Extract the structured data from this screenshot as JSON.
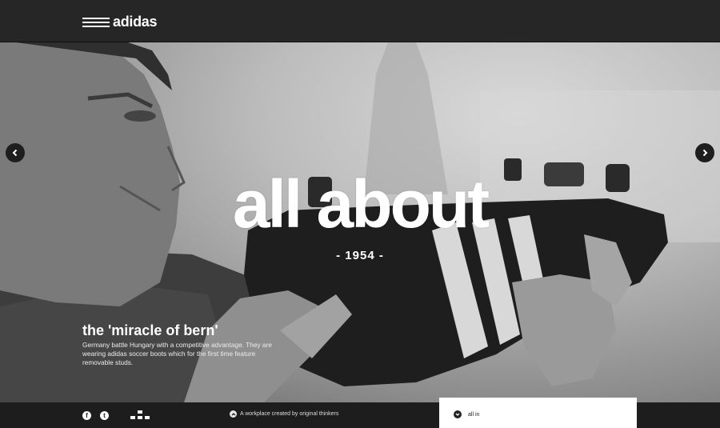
{
  "header": {
    "brand": "adidas"
  },
  "hero": {
    "headline": "all about",
    "year": "- 1954 -",
    "story_title": "the 'miracle of bern'",
    "story_body": "Germany battle Hungary with a competitive advantage. They are wearing adidas soccer boots which for the first time feature removable studs."
  },
  "footer": {
    "facebook_label": "f",
    "twitter_label": "t",
    "tagline": "A workplace created by original thinkers",
    "menu_label": "all in"
  },
  "icons": {
    "prev": "chevron-left-icon",
    "next": "chevron-right-icon",
    "grid": "grid-icon",
    "up": "chevron-up-icon",
    "down": "chevron-down-icon"
  },
  "colors": {
    "topbar": "#262626",
    "bottombar": "#1d1d1d",
    "text": "#ffffff",
    "panel": "#ffffff"
  }
}
